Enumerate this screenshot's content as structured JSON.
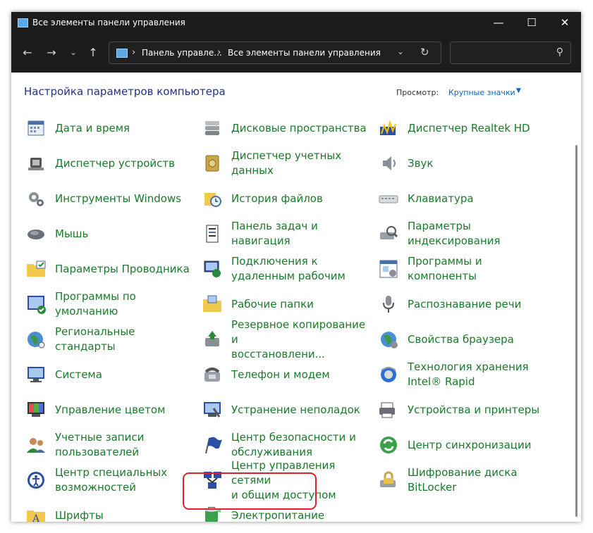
{
  "window": {
    "title": "Все элементы панели управления",
    "minimize_icon": "minimize-icon",
    "maximize_icon": "maximize-icon",
    "close_icon": "close-icon"
  },
  "nav": {
    "breadcrumb": [
      "Панель управле...",
      "Все элементы панели управления"
    ],
    "search_placeholder": ""
  },
  "header": {
    "title": "Настройка параметров компьютера",
    "view_label": "Просмотр:",
    "view_value": "Крупные значки"
  },
  "colors": {
    "item_text": "#1a7a2a",
    "heading": "#1e3287",
    "link": "#0066cc",
    "highlight": "#e0202a",
    "titlebar": "#1c1c1c"
  },
  "items": [
    {
      "label": "Дата и время",
      "icon": "calendar-clock-icon"
    },
    {
      "label": "Дисковые пространства",
      "icon": "storage-spaces-icon"
    },
    {
      "label": "Диспетчер Realtek HD",
      "icon": "realtek-audio-icon"
    },
    {
      "label": "Диспетчер устройств",
      "icon": "device-manager-icon"
    },
    {
      "label": "Диспетчер учетных\nданных",
      "icon": "credential-vault-icon"
    },
    {
      "label": "Звук",
      "icon": "speaker-icon"
    },
    {
      "label": "Инструменты Windows",
      "icon": "gears-icon"
    },
    {
      "label": "История файлов",
      "icon": "file-history-icon"
    },
    {
      "label": "Клавиатура",
      "icon": "keyboard-icon"
    },
    {
      "label": "Мышь",
      "icon": "mouse-icon"
    },
    {
      "label": "Панель задач и\nнавигация",
      "icon": "taskbar-icon"
    },
    {
      "label": "Параметры\nиндексирования",
      "icon": "indexing-icon"
    },
    {
      "label": "Параметры Проводника",
      "icon": "folder-options-icon"
    },
    {
      "label": "Подключения к\nудаленным рабочим",
      "icon": "remote-desktop-icon"
    },
    {
      "label": "Программы и\nкомпоненты",
      "icon": "programs-icon"
    },
    {
      "label": "Программы по\nумолчанию",
      "icon": "default-programs-icon"
    },
    {
      "label": "Рабочие папки",
      "icon": "work-folders-icon"
    },
    {
      "label": "Распознавание речи",
      "icon": "microphone-icon"
    },
    {
      "label": "Региональные стандарты",
      "icon": "region-globe-icon"
    },
    {
      "label": "Резервное копирование и\nвосстановлени...",
      "icon": "backup-icon"
    },
    {
      "label": "Свойства браузера",
      "icon": "internet-options-icon"
    },
    {
      "label": "Система",
      "icon": "system-monitor-icon"
    },
    {
      "label": "Телефон и модем",
      "icon": "phone-modem-icon"
    },
    {
      "label": "Технология хранения\nIntel® Rapid",
      "icon": "intel-rapid-icon"
    },
    {
      "label": "Управление цветом",
      "icon": "color-management-icon"
    },
    {
      "label": "Устранение неполадок",
      "icon": "troubleshooting-icon"
    },
    {
      "label": "Устройства и принтеры",
      "icon": "printer-icon"
    },
    {
      "label": "Учетные записи\nпользователей",
      "icon": "user-accounts-icon"
    },
    {
      "label": "Центр безопасности и\nобслуживания",
      "icon": "security-flag-icon"
    },
    {
      "label": "Центр синхронизации",
      "icon": "sync-center-icon"
    },
    {
      "label": "Центр специальных\nвозможностей",
      "icon": "accessibility-icon"
    },
    {
      "label": "Центр управления сетями\nи общим доступом",
      "icon": "network-center-icon"
    },
    {
      "label": "Шифрование диска\nBitLocker",
      "icon": "bitlocker-icon"
    },
    {
      "label": "Шрифты",
      "icon": "fonts-icon"
    },
    {
      "label": "Электропитание",
      "icon": "power-options-icon"
    }
  ]
}
